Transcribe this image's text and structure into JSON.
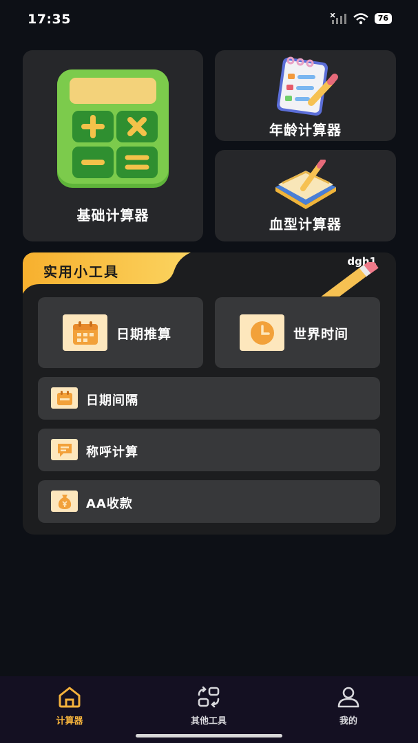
{
  "status_bar": {
    "time": "17:35",
    "battery": "76"
  },
  "cards": {
    "basic": {
      "label": "基础计算器"
    },
    "age": {
      "label": "年龄计算器"
    },
    "blood": {
      "label": "血型计算器"
    }
  },
  "tools": {
    "title": "实用小工具",
    "watermark": "dgh1",
    "date_calc": {
      "label": "日期推算",
      "icon": "calendar-icon"
    },
    "world_time": {
      "label": "世界时间",
      "icon": "clock-icon"
    },
    "date_interval": {
      "label": "日期间隔",
      "icon": "calendar-small-icon"
    },
    "kinship": {
      "label": "称呼计算",
      "icon": "message-icon"
    },
    "aa_pay": {
      "label": "AA收款",
      "icon": "money-bag-icon"
    }
  },
  "nav": {
    "home": {
      "label": "计算器",
      "icon": "home-icon"
    },
    "tools": {
      "label": "其他工具",
      "icon": "swap-icon"
    },
    "mine": {
      "label": "我的",
      "icon": "user-icon"
    }
  },
  "colors": {
    "accent": "#f4b23c",
    "card": "#26272a",
    "tile": "#37383a",
    "icon_bg": "#fde7bd"
  }
}
